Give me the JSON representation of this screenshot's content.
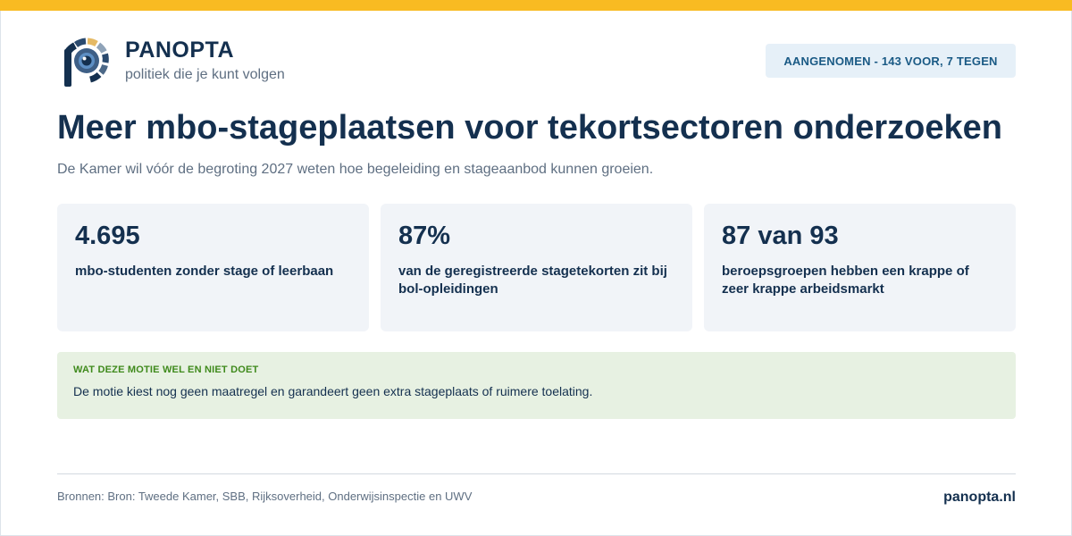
{
  "brand": {
    "name": "PANOPTA",
    "tagline": "politiek die je kunt volgen",
    "logo_icon": "panopta-eye-logo-icon"
  },
  "status": {
    "label": "AANGENOMEN - 143 VOOR, 7 TEGEN"
  },
  "headline": {
    "title": "Meer mbo-stageplaatsen voor tekortsectoren onderzoeken",
    "subtitle": "De Kamer wil vóór de begroting 2027 weten hoe begeleiding en stageaanbod kunnen groeien."
  },
  "stats": [
    {
      "value": "4.695",
      "label": "mbo-studenten zonder stage of leerbaan"
    },
    {
      "value": "87%",
      "label": "van de geregistreerde stagetekorten zit bij bol-opleidingen"
    },
    {
      "value": "87 van 93",
      "label": "beroepsgroepen hebben een krappe of zeer krappe arbeidsmarkt"
    }
  ],
  "note": {
    "heading": "WAT DEZE MOTIE WEL EN NIET DOET",
    "text": "De motie kiest nog geen maatregel en garandeert geen extra stageplaats of ruimere toelating."
  },
  "footer": {
    "sources": "Bronnen: Bron: Tweede Kamer, SBB, Rijksoverheid, Onderwijsinspectie en UWV",
    "site": "panopta.nl"
  },
  "colors": {
    "accent_bar": "#f9bb22",
    "navy": "#14304f",
    "badge_bg": "#e6f0f8",
    "card_bg": "#f1f4f8",
    "note_bg": "#e7f1e2",
    "note_heading": "#3f8a1c"
  }
}
